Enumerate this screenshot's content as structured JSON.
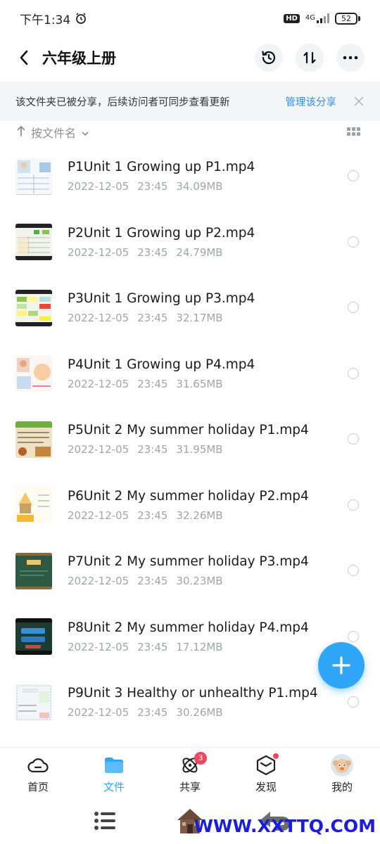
{
  "status_bar": {
    "time": "下午1:34",
    "hd": "HD",
    "network": "4G",
    "battery": "52"
  },
  "header": {
    "title": "六年级上册"
  },
  "banner": {
    "text": "该文件夹已被分享，后续访问者可同步查看更新",
    "link": "管理该分享"
  },
  "sort": {
    "label": "按文件名"
  },
  "files": [
    {
      "name": "P1Unit 1 Growing up P1.mp4",
      "date": "2022-12-05",
      "time": "23:45",
      "size": "34.09MB"
    },
    {
      "name": "P2Unit 1 Growing up P2.mp4",
      "date": "2022-12-05",
      "time": "23:45",
      "size": "24.79MB"
    },
    {
      "name": "P3Unit 1 Growing up P3.mp4",
      "date": "2022-12-05",
      "time": "23:45",
      "size": "32.17MB"
    },
    {
      "name": "P4Unit 1 Growing up P4.mp4",
      "date": "2022-12-05",
      "time": "23:45",
      "size": "31.65MB"
    },
    {
      "name": "P5Unit 2 My summer holiday P1.mp4",
      "date": "2022-12-05",
      "time": "23:45",
      "size": "31.95MB"
    },
    {
      "name": "P6Unit 2 My summer holiday P2.mp4",
      "date": "2022-12-05",
      "time": "23:45",
      "size": "32.26MB"
    },
    {
      "name": "P7Unit 2 My summer holiday P3.mp4",
      "date": "2022-12-05",
      "time": "23:45",
      "size": "30.23MB"
    },
    {
      "name": "P8Unit 2 My summer holiday P4.mp4",
      "date": "2022-12-05",
      "time": "23:45",
      "size": "17.12MB"
    },
    {
      "name": "P9Unit 3 Healthy or unhealthy P1.mp4",
      "date": "2022-12-05",
      "time": "23:45",
      "size": "30.26MB"
    }
  ],
  "bottom_nav": {
    "home": "首页",
    "files": "文件",
    "share": "共享",
    "share_badge": "3",
    "discover": "发现",
    "mine": "我的"
  },
  "watermark": "WWW.XXTTQ.COM",
  "colors": {
    "accent": "#2fa6f7",
    "link": "#2e8ff0",
    "badge": "#f2445d"
  }
}
